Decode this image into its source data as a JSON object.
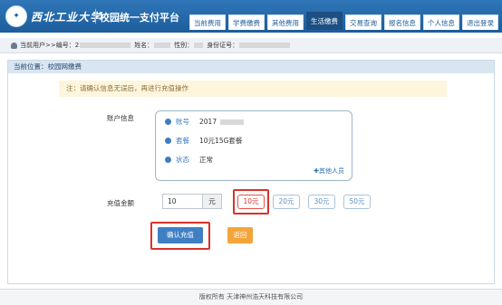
{
  "header": {
    "school_name": "西北工业大学",
    "platform_title": "校园统一支付平台",
    "nav": [
      "当前费用",
      "学费缴费",
      "其他费用",
      "生活缴费",
      "交易查询",
      "报名信息",
      "个人信息",
      "退出登录"
    ],
    "active_nav": "生活缴费"
  },
  "userbar": {
    "current_user_label": "当前用户>>编号：2",
    "name_label": "姓名：",
    "gender_label": "性别：",
    "id_label": "身份证号："
  },
  "breadcrumb": "当前位置：校园网缴费",
  "notice": "注：请确认信息无误后，再进行充值操作",
  "account": {
    "label": "账户信息",
    "rows": [
      {
        "icon": "user-icon",
        "key": "账号",
        "value": "2017"
      },
      {
        "icon": "globe-icon",
        "key": "套餐",
        "value": "10元15G套餐"
      },
      {
        "icon": "info-icon",
        "key": "状态",
        "value": "正常"
      }
    ],
    "others_link": "✚其他人员"
  },
  "recharge": {
    "label": "充值金额",
    "input_value": "10",
    "unit": "元",
    "options": [
      "10元",
      "20元",
      "30元",
      "50元"
    ],
    "selected": "10元"
  },
  "buttons": {
    "confirm": "确认充值",
    "back": "返回"
  },
  "footer": "版权所有 天津神州浩天科技有限公司",
  "colors": {
    "header_blue": "#1d5d9c",
    "highlight_red": "#d9322b",
    "confirm_blue": "#3f7fc4",
    "back_orange": "#f3a53a"
  }
}
